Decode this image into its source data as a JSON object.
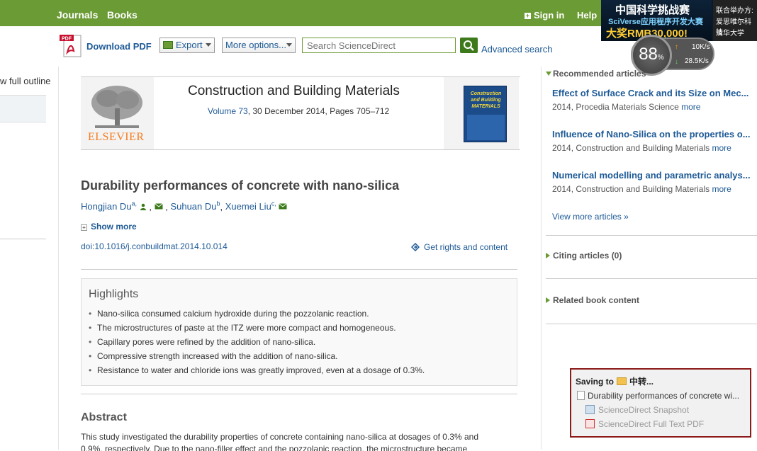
{
  "topbar": {
    "nav": [
      "Journals",
      "Books"
    ],
    "signin": "Sign in",
    "help": "Help"
  },
  "ad": {
    "line1": "中国科学挑战赛",
    "line2": "SciVerse应用程序开发大赛",
    "line3": "大奖RMB30,000!",
    "org1": "联合举办方:",
    "org2": "爱思唯尔科技",
    "org3": "清华大学"
  },
  "speed": {
    "percent": "88",
    "percent_unit": "%",
    "up": "10K/s",
    "down": "28.5K/s"
  },
  "toolbar": {
    "pdf_badge": "PDF",
    "download_pdf": "Download PDF",
    "export": "Export",
    "more_options": "More options...",
    "search_placeholder": "Search ScienceDirect",
    "advanced_search": "Advanced search"
  },
  "outline": {
    "view_full_outline": "w full outline"
  },
  "journal": {
    "publisher": "ELSEVIER",
    "title": "Construction and Building Materials",
    "volume_link": "Volume 73",
    "volume_rest": ", 30 December 2014, Pages 705–712",
    "cover_title": "Construction and Building MATERIALS"
  },
  "article": {
    "title": "Durability performances of concrete with nano-silica",
    "authors": [
      {
        "name": "Hongjian Du",
        "sup": "a,"
      },
      {
        "name": "Suhuan Du",
        "sup": "b"
      },
      {
        "name": "Xuemei Liu",
        "sup": "c,"
      }
    ],
    "show_more": "Show more",
    "doi": "doi:10.1016/j.conbuildmat.2014.10.014",
    "rights": "Get rights and content"
  },
  "highlights": {
    "title": "Highlights",
    "items": [
      "Nano-silica consumed calcium hydroxide during the pozzolanic reaction.",
      "The microstructures of paste at the ITZ were more compact and homogeneous.",
      "Capillary pores were refined by the addition of nano-silica.",
      "Compressive strength increased with the addition of nano-silica.",
      "Resistance to water and chloride ions was greatly improved, even at a dosage of 0.3%."
    ]
  },
  "abstract": {
    "title": "Abstract",
    "text": "This study investigated the durability properties of concrete containing nano-silica at dosages of 0.3% and",
    "text2": "0.9%, respectively. Due to the nano-filler effect and the pozzolanic reaction, the microstructure became"
  },
  "sidebar": {
    "recommended_title": "Recommended articles",
    "recommended": [
      {
        "title": "Effect of Surface Crack and its Size on Mec...",
        "meta": "2014, Procedia Materials Science",
        "more": "more"
      },
      {
        "title": "Influence of Nano-Silica on the properties o...",
        "meta": "2014, Construction and Building Materials",
        "more": "more"
      },
      {
        "title": "Numerical modelling and parametric analys...",
        "meta": "2014, Construction and Building Materials",
        "more": "more"
      }
    ],
    "view_more": "View more articles »",
    "citing": "Citing articles (0)",
    "related": "Related book content"
  },
  "saving": {
    "title_prefix": "Saving to",
    "folder": "中转...",
    "doc": "Durability performances of concrete wi...",
    "snapshot": "ScienceDirect Snapshot",
    "fulltext": "ScienceDirect Full Text PDF"
  }
}
